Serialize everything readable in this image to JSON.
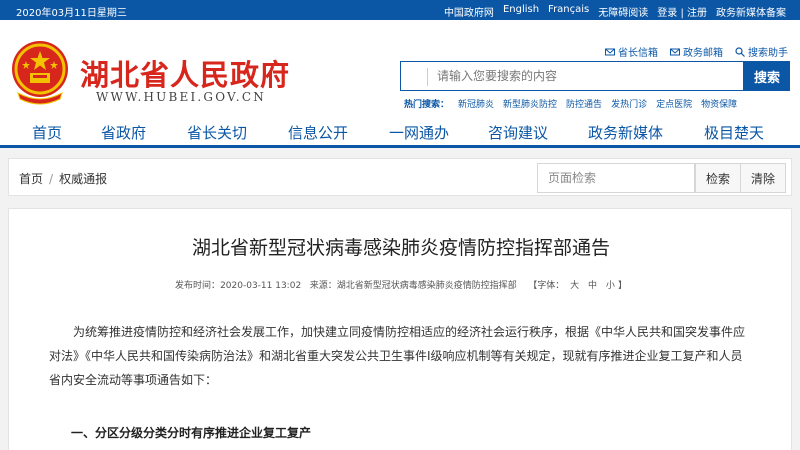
{
  "topbar": {
    "date": "2020年03月11日星期三",
    "links": [
      "中国政府网",
      "English",
      "Français",
      "无障碍阅读",
      "登录",
      "注册",
      "政务新媒体备案"
    ]
  },
  "header": {
    "title": "湖北省人民政府",
    "url": "WWW.HUBEI.GOV.CN",
    "utils": {
      "mailbox": "省长信箱",
      "govmail": "政务邮箱",
      "assist": "搜索助手"
    },
    "search": {
      "placeholder": "请输入您要搜索的内容",
      "button": "搜索"
    },
    "hot": {
      "label": "热门搜索：",
      "keywords": [
        "新冠肺炎",
        "新型肺炎防控",
        "防控通告",
        "发热门诊",
        "定点医院",
        "物资保障"
      ]
    }
  },
  "nav": {
    "items": [
      "首页",
      "省政府",
      "省长关切",
      "信息公开",
      "一网通办",
      "咨询建议",
      "政务新媒体",
      "极目楚天"
    ]
  },
  "breadcrumb": {
    "home": "首页",
    "sep": "/",
    "current": "权威通报",
    "search_placeholder": "页面检索",
    "search_btn": "检索",
    "clear_btn": "清除"
  },
  "article": {
    "title": "湖北省新型冠状病毒感染肺炎疫情防控指挥部通告",
    "published_label": "发布时间：",
    "published": "2020-03-11 13:02",
    "source_label": "来源：",
    "source": "湖北省新型冠状病毒感染肺炎疫情防控指挥部",
    "font_label": "【字体：",
    "font_large": "大",
    "font_medium": "中",
    "font_small": "小",
    "font_end": "】",
    "paragraph": "为统筹推进疫情防控和经济社会发展工作，加快建立同疫情防控相适应的经济社会运行秩序，根据《中华人民共和国突发事件应对法》《中华人民共和国传染病防治法》和湖北省重大突发公共卫生事件Ⅰ级响应机制等有关规定，现就有序推进企业复工复产和人员省内安全流动等事项通告如下：",
    "section1": "一、分区分级分类分时有序推进企业复工复产"
  },
  "colors": {
    "brand_blue": "#0b57a6",
    "title_red": "#d7261b"
  }
}
